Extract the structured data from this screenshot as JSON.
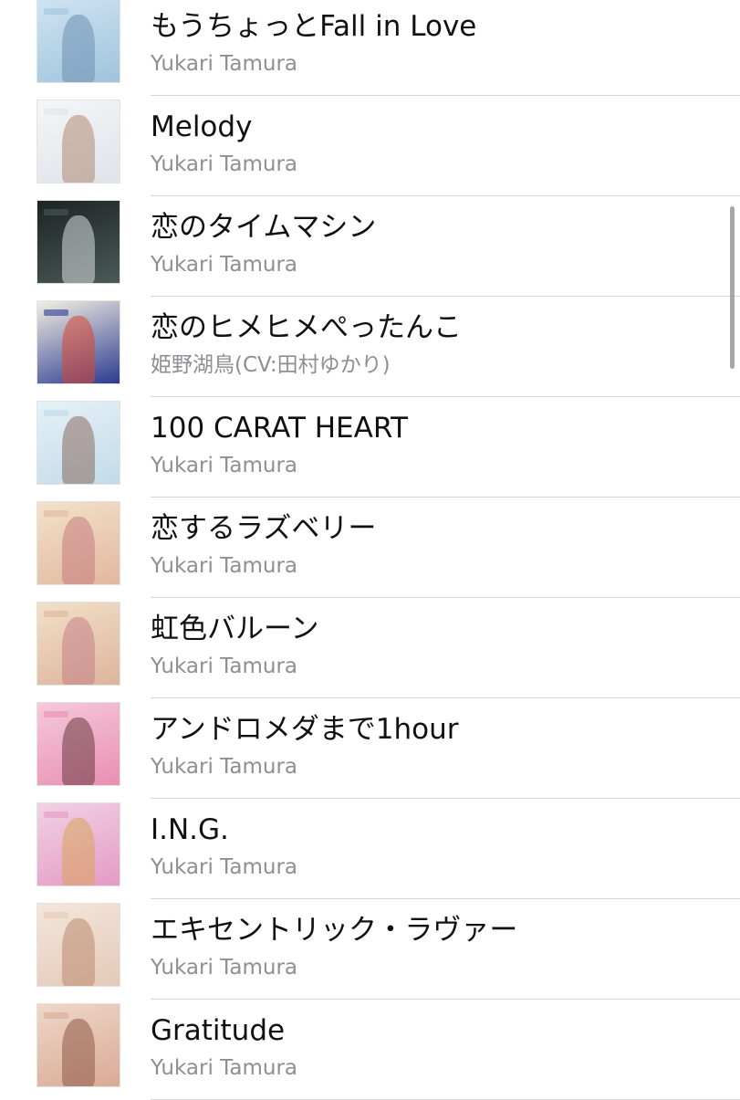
{
  "songs": [
    {
      "title": "もうちょっとFall in Love",
      "artist": "Yukari Tamura",
      "art_colors": [
        "#cfe3f2",
        "#9fc4dc",
        "#6d8fb3"
      ]
    },
    {
      "title": "Melody",
      "artist": "Yukari Tamura",
      "art_colors": [
        "#f4f6f8",
        "#dfe3e8",
        "#b08a73"
      ]
    },
    {
      "title": "恋のタイムマシン",
      "artist": "Yukari Tamura",
      "art_colors": [
        "#1e2324",
        "#4a5a58",
        "#d8dede"
      ]
    },
    {
      "title": "恋のヒメヒメぺったんこ",
      "artist": "姫野湖鳥(CV:田村ゆかり)",
      "art_colors": [
        "#f3efe4",
        "#2b3b8f",
        "#d8452f"
      ]
    },
    {
      "title": "100 CARAT HEART",
      "artist": "Yukari Tamura",
      "art_colors": [
        "#e6f1f7",
        "#c2dbe9",
        "#8a6c60"
      ]
    },
    {
      "title": "恋するラズベリー",
      "artist": "Yukari Tamura",
      "art_colors": [
        "#f3e2c9",
        "#e2b7a0",
        "#c77b7e"
      ]
    },
    {
      "title": "虹色バルーン",
      "artist": "Yukari Tamura",
      "art_colors": [
        "#f2e0c8",
        "#ddb49c",
        "#c47f86"
      ]
    },
    {
      "title": "アンドロメダまで1hour",
      "artist": "Yukari Tamura",
      "art_colors": [
        "#f6c9da",
        "#e88fb3",
        "#6a3b3f"
      ]
    },
    {
      "title": "I.N.G.",
      "artist": "Yukari Tamura",
      "art_colors": [
        "#f0d2e4",
        "#e59ac3",
        "#d9a45a"
      ]
    },
    {
      "title": "エキセントリック・ラヴァー",
      "artist": "Yukari Tamura",
      "art_colors": [
        "#f4e6dc",
        "#e4c9b7",
        "#b98a70"
      ]
    },
    {
      "title": "Gratitude",
      "artist": "Yukari Tamura",
      "art_colors": [
        "#efd7c8",
        "#d9aa95",
        "#8e5a49"
      ]
    }
  ],
  "colors": {
    "title_text": "#111111",
    "artist_text": "#8e8e93",
    "separator": "#d6d6d8",
    "scroll_indicator": "#8a8a8e"
  }
}
